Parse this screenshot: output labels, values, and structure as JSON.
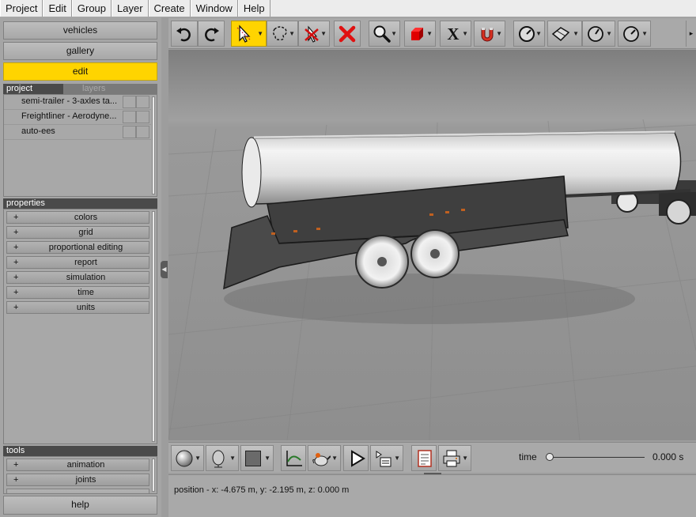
{
  "menu": [
    "Project",
    "Edit",
    "Group",
    "Layer",
    "Create",
    "Window",
    "Help"
  ],
  "left": {
    "vehicles_label": "vehicles",
    "gallery_label": "gallery",
    "edit_label": "edit",
    "project_tab": "project",
    "layers_tab": "layers",
    "project_items": [
      "semi-trailer - 3-axles ta...",
      "Freightliner - Aerodyne...",
      "auto-ees"
    ],
    "properties_header": "properties",
    "properties": [
      "colors",
      "grid",
      "proportional editing",
      "report",
      "simulation",
      "time",
      "units"
    ],
    "tools_header": "tools",
    "tools": [
      "animation",
      "joints"
    ],
    "help_label": "help",
    "plus": "+"
  },
  "toolbar": {
    "icons": [
      "undo-icon",
      "redo-icon",
      "select-arrow-icon",
      "lasso-icon",
      "delete-selection-icon",
      "delete-icon",
      "zoom-icon",
      "box-icon",
      "axis-x-icon",
      "magnet-icon",
      "gauge-icon",
      "plane-icon",
      "rotate-gauge-icon",
      "rotate-gauge-2-icon"
    ],
    "x_label": "X",
    "more": "▸"
  },
  "bottom": {
    "time_label": "time",
    "time_value": "0.000 s",
    "slider_fraction": 0
  },
  "status": {
    "text": "position - x: -4.675 m, y: -2.195 m, z: 0.000 m"
  },
  "colors": {
    "accent": "#ffd400",
    "panel": "#a5a5a5",
    "header": "#4a4a4a"
  }
}
